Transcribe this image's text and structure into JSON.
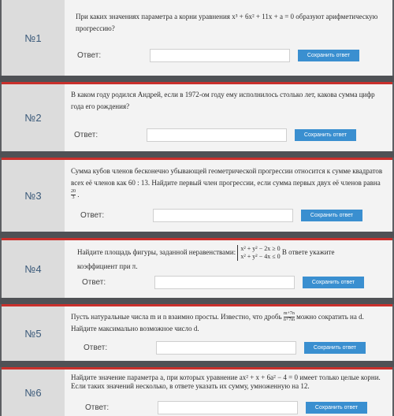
{
  "problems": [
    {
      "number": "№1",
      "text": "При каких значениях параметра a корни уравнения x³ + 6x² + 11x + a = 0 образуют арифметическую прогрессию?",
      "answer_label": "Ответ:",
      "save_label": "Сохранить ответ"
    },
    {
      "number": "№2",
      "text": "В каком году родился Андрей, если в 1972-ом году ему исполнилось столько лет, какова сумма цифр года его рождения?",
      "answer_label": "Ответ:",
      "save_label": "Сохранить ответ"
    },
    {
      "number": "№3",
      "text_before": "Сумма кубов членов бесконечно убывающей геометрической прогрессии относится к сумме квадратов всех её членов как 60 : 13. Найдите первый член прогрессии, если сумма первых двух её членов равна",
      "frac_num": "20",
      "frac_den": "3",
      "text_after": ".",
      "answer_label": "Ответ:",
      "save_label": "Сохранить ответ"
    },
    {
      "number": "№4",
      "text_before": "Найдите площадь фигуры, заданной неравенствами:",
      "system": [
        "x² + y² − 2x ≥ 0",
        "x² + y² − 4x ≤ 0"
      ],
      "text_after": "В ответе укажите",
      "text_line2": "коэффициент при π.",
      "answer_label": "Ответ:",
      "save_label": "Сохранить ответ"
    },
    {
      "number": "№5",
      "text_before": "Пусть натуральные числа m и n взаимно просты. Известно, что дробь",
      "frac_num": "m+7n",
      "frac_den": "n+7m",
      "text_after": "можно сократить на d. Найдите максимально возможное число d.",
      "answer_label": "Ответ:",
      "save_label": "Сохранить ответ"
    },
    {
      "number": "№6",
      "text": "Найдите значение параметра a, при которых уравнение ax² + x + 6a² − 4 = 0 имеет только целые корни. Если таких значений несколько, в ответе указать их сумму, умноженную на 12.",
      "answer_label": "Ответ:",
      "save_label": "Сохранить ответ"
    }
  ]
}
